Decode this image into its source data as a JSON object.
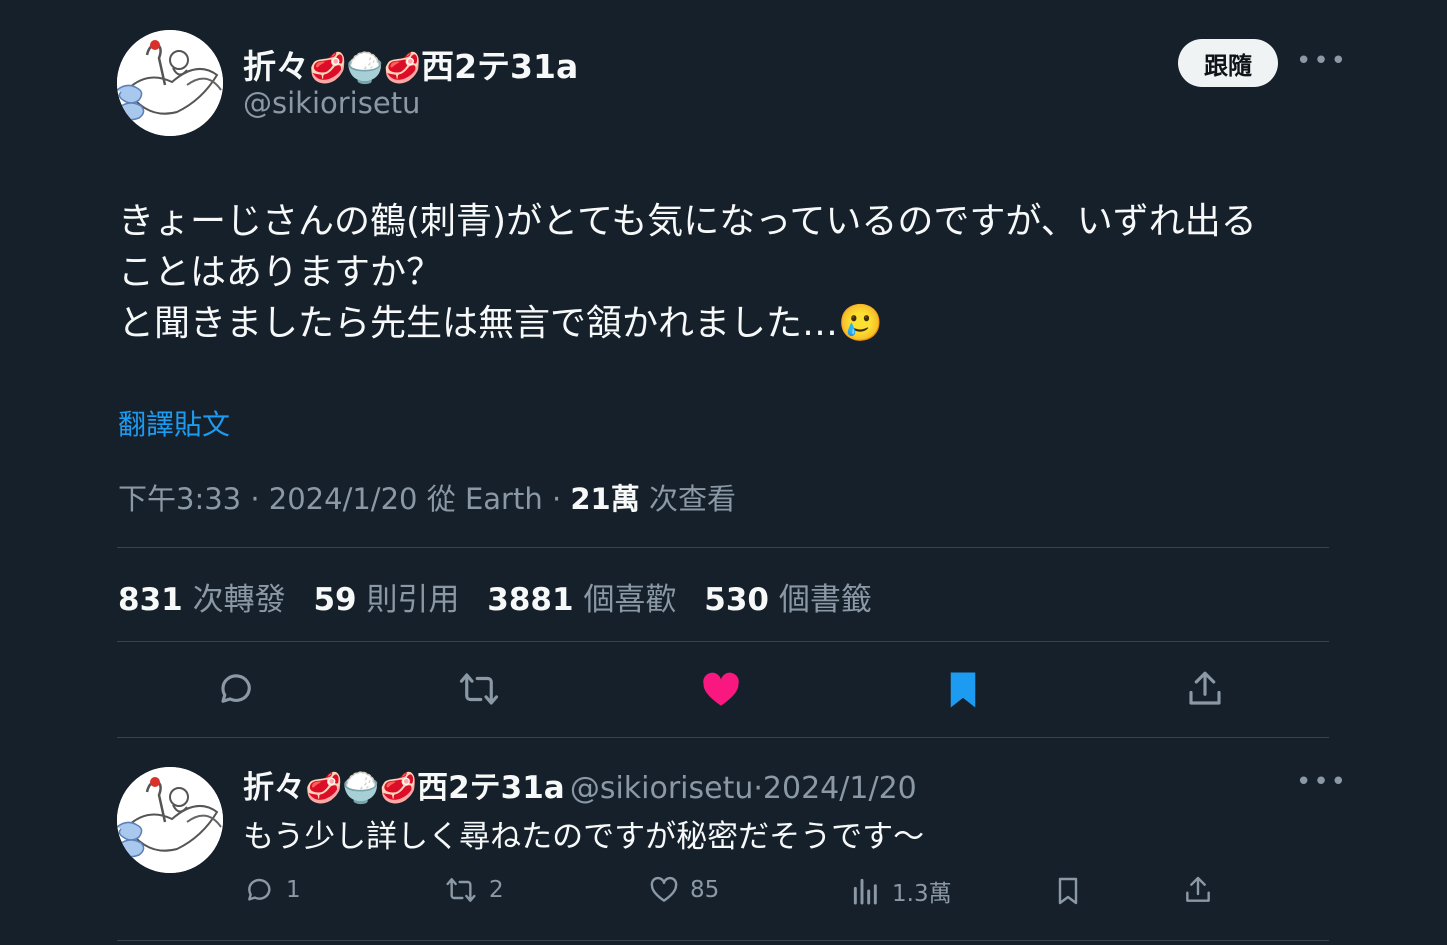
{
  "tweet": {
    "author": {
      "name_prefix": "折々",
      "name_emoji_1": "🥩",
      "name_emoji_2": "🍚",
      "name_emoji_3": "🥩",
      "name_suffix": "西2テ31a",
      "handle": "@sikiorisetu"
    },
    "follow_label": "跟隨",
    "more_label": "•••",
    "text_line1": "きょーじさんの鶴(刺青)がとても気になっているのですが、いずれ出る",
    "text_line2": "ことはありますか？",
    "text_line3": "と聞きましたら先生は無言で頷かれました…🥲",
    "translate_label": "翻譯貼文",
    "time": "下午3:33",
    "date": "2024/1/20",
    "source_prefix": "從",
    "source": "Earth",
    "views_count": "21萬",
    "views_label": "次查看",
    "separator": "·",
    "stats": {
      "retweets_count": "831",
      "retweets_label": "次轉發",
      "quotes_count": "59",
      "quotes_label": "則引用",
      "likes_count": "3881",
      "likes_label": "個喜歡",
      "bookmarks_count": "530",
      "bookmarks_label": "個書籤"
    }
  },
  "reply": {
    "author": {
      "name_prefix": "折々",
      "name_emoji_1": "🥩",
      "name_emoji_2": "🍚",
      "name_emoji_3": "🥩",
      "name_suffix": "西2テ31a",
      "handle": "@sikiorisetu"
    },
    "separator": "·",
    "date": "2024/1/20",
    "text": "もう少し詳しく尋ねたのですが秘密だそうです～",
    "more_label": "•••",
    "actions": {
      "replies": "1",
      "retweets": "2",
      "likes": "85",
      "views": "1.3萬"
    }
  },
  "colors": {
    "background": "#15202b",
    "text": "#f7f9f9",
    "secondary": "#8b98a5",
    "link": "#1d9bf0",
    "like": "#f91880",
    "bookmark": "#1d9bf0",
    "divider": "#38444d"
  }
}
